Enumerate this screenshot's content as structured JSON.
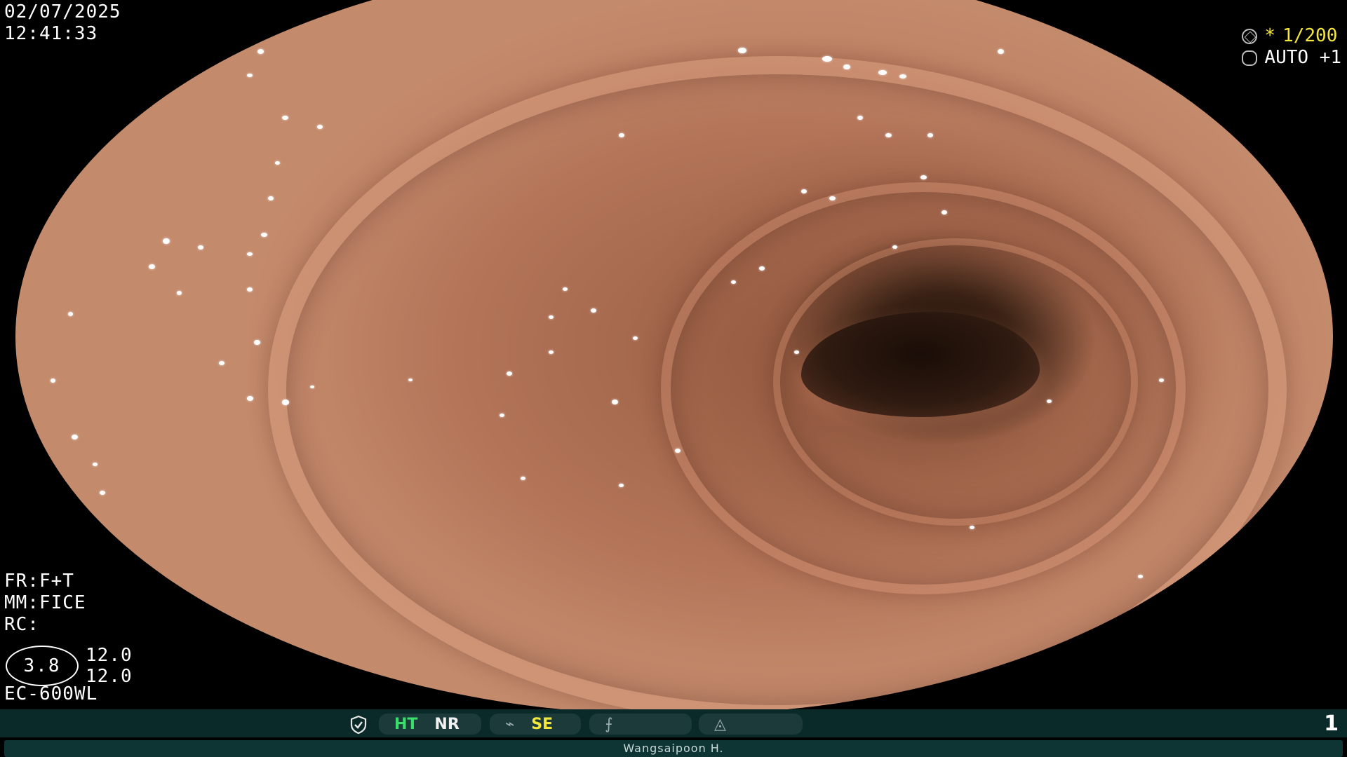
{
  "overlay": {
    "date": "02/07/2025",
    "time": "12:41:33",
    "shutter": "1/200",
    "shutter_prefix": "*",
    "iris": "AUTO +1",
    "fr": "FR:F+T",
    "mm": "MM:FICE",
    "rc": "RC:",
    "zoom": "3.8",
    "zoom_val_1": "12.0",
    "zoom_val_2": "12.0",
    "model": "EC-600WL"
  },
  "status_bar": {
    "ht": "HT",
    "nr": "NR",
    "se": "SE",
    "page_number": "1",
    "operator": "Wangsaipoon H."
  },
  "icons": {
    "shutter": "shutter-icon",
    "iris": "iris-icon",
    "shield": "shield-check-icon",
    "scope": "scope-icon",
    "function": "function-icon",
    "capture": "capture-icon"
  },
  "colors": {
    "highlight_yellow": "#f4e63a",
    "ht_green": "#3adf6a",
    "status_bar": "#0a2a2a"
  }
}
